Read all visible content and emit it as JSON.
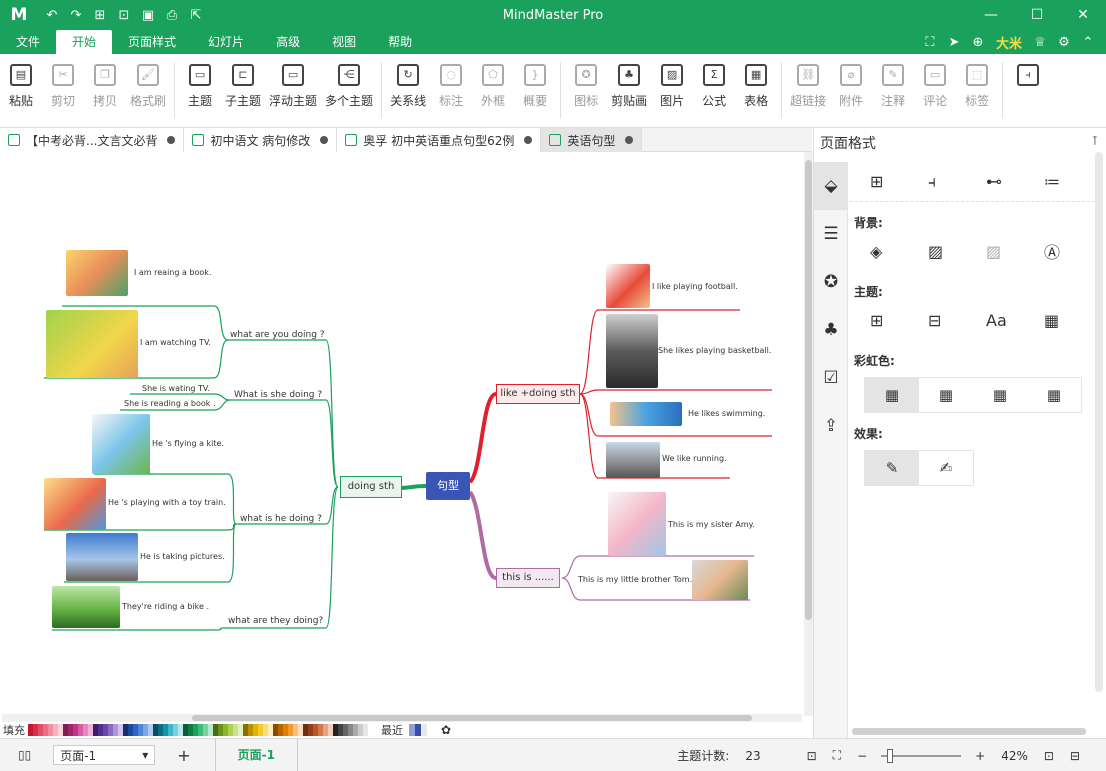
{
  "app": {
    "title": "MindMaster Pro",
    "logo": "M",
    "quick_access_icons": [
      "undo-icon",
      "redo-icon",
      "new-icon",
      "open-icon",
      "save-icon",
      "print-icon",
      "export-icon"
    ],
    "user": "大米"
  },
  "menu": {
    "items": [
      "文件",
      "开始",
      "页面样式",
      "幻灯片",
      "高级",
      "视图",
      "帮助"
    ],
    "active": "开始"
  },
  "ribbon": {
    "buttons": [
      {
        "label": "粘贴",
        "icon": "paste-icon",
        "glyph": "▤",
        "disabled": false
      },
      {
        "label": "剪切",
        "icon": "cut-icon",
        "glyph": "✂",
        "disabled": true
      },
      {
        "label": "拷贝",
        "icon": "copy-icon",
        "glyph": "❐",
        "disabled": true
      },
      {
        "label": "格式刷",
        "icon": "format-brush-icon",
        "glyph": "🖌",
        "disabled": true
      },
      {
        "label": "主题",
        "icon": "topic-icon",
        "glyph": "▭",
        "disabled": false
      },
      {
        "label": "子主题",
        "icon": "subtopic-icon",
        "glyph": "⊏",
        "disabled": false
      },
      {
        "label": "浮动主题",
        "icon": "floating-topic-icon",
        "glyph": "▭",
        "disabled": false
      },
      {
        "label": "多个主题",
        "icon": "multi-topic-icon",
        "glyph": "⋲",
        "disabled": false
      },
      {
        "label": "关系线",
        "icon": "relation-icon",
        "glyph": "↻",
        "disabled": false
      },
      {
        "label": "标注",
        "icon": "callout-icon",
        "glyph": "◌",
        "disabled": true
      },
      {
        "label": "外框",
        "icon": "boundary-icon",
        "glyph": "⬠",
        "disabled": true
      },
      {
        "label": "概要",
        "icon": "summary-icon",
        "glyph": "}",
        "disabled": true
      },
      {
        "label": "图标",
        "icon": "mark-icon",
        "glyph": "✪",
        "disabled": true
      },
      {
        "label": "剪贴画",
        "icon": "clipart-icon",
        "glyph": "♣",
        "disabled": false
      },
      {
        "label": "图片",
        "icon": "picture-icon",
        "glyph": "▨",
        "disabled": false
      },
      {
        "label": "公式",
        "icon": "formula-icon",
        "glyph": "Σ",
        "disabled": false
      },
      {
        "label": "表格",
        "icon": "table-icon",
        "glyph": "▦",
        "disabled": false
      },
      {
        "label": "超链接",
        "icon": "hyperlink-icon",
        "glyph": "⛓",
        "disabled": true
      },
      {
        "label": "附件",
        "icon": "attachment-icon",
        "glyph": "⌀",
        "disabled": true
      },
      {
        "label": "注释",
        "icon": "note-icon",
        "glyph": "✎",
        "disabled": true
      },
      {
        "label": "评论",
        "icon": "comment-icon",
        "glyph": "▭",
        "disabled": true
      },
      {
        "label": "标签",
        "icon": "tag-icon",
        "glyph": "⬚",
        "disabled": true
      }
    ]
  },
  "tabs": [
    {
      "label": "【中考必背...文言文必背",
      "active": false
    },
    {
      "label": "初中语文 病句修改",
      "active": false
    },
    {
      "label": "奥孚 初中英语重点句型62例",
      "active": false
    },
    {
      "label": "英语句型",
      "active": true
    }
  ],
  "mindmap": {
    "root": "句型",
    "left_main": "doing sth",
    "left_branches": [
      {
        "label": "what are you doing ?",
        "leaves": [
          "I am reaing a book.",
          "I am watching TV."
        ]
      },
      {
        "label": "What  is she doing ?",
        "leaves": [
          "She  is wating TV.",
          "She is reading a book ."
        ]
      },
      {
        "label": "what is he doing ?",
        "leaves": [
          "He 's flying a kite.",
          "He 's playing with a toy train.",
          "He is taking pictures."
        ]
      },
      {
        "label": "what are  they doing?",
        "leaves": [
          "They're riding a bike ."
        ]
      }
    ],
    "right_branches": [
      {
        "label": "like +doing sth",
        "leaves": [
          "I like playing football.",
          "She likes playing basketball.",
          "He likes swimming.",
          "We like running."
        ]
      },
      {
        "label": "this is ......",
        "leaves": [
          "This is my sister Amy.",
          "This is my little brother Tom."
        ]
      }
    ]
  },
  "panel": {
    "title": "页面格式",
    "sections": {
      "background": "背景:",
      "theme": "主题:",
      "rainbow": "彩虹色:",
      "effect": "效果:"
    }
  },
  "colorbar": {
    "fill_label": "填充",
    "recent_label": "最近",
    "swatches": [
      "#c4172c",
      "#d6314a",
      "#e04f68",
      "#ea6f86",
      "#f08fa1",
      "#f7b2bf",
      "#fbd3da",
      "#7f1d4d",
      "#a0266a",
      "#c13386",
      "#d75aa3",
      "#e685bf",
      "#f0b0d7",
      "#3b1c6d",
      "#51308e",
      "#6a48ab",
      "#8a6cc4",
      "#ad97da",
      "#d0c4ec",
      "#13306c",
      "#1c4b9e",
      "#2d66c4",
      "#4e86d8",
      "#7ca7e6",
      "#b0cbf2",
      "#064e5b",
      "#0a6f82",
      "#1493ab",
      "#40b4c9",
      "#7ad0df",
      "#b6e7ef",
      "#0b5b33",
      "#117a45",
      "#1aa15c",
      "#3dbb7a",
      "#78d3a2",
      "#b5ead0",
      "#4a6a0e",
      "#6b931a",
      "#8cb72a",
      "#abd154",
      "#c9e38d",
      "#e3f1c2",
      "#8a6d00",
      "#b89200",
      "#e0b500",
      "#f2cc2d",
      "#f8de76",
      "#fcefbc",
      "#8a4a00",
      "#b86500",
      "#e07f00",
      "#f29b2d",
      "#f8bd76",
      "#fcdcbc",
      "#6e2e12",
      "#94411b",
      "#ba5628",
      "#d17a50",
      "#e3a488",
      "#f2cdbd",
      "#222222",
      "#444444",
      "#666666",
      "#888888",
      "#aaaaaa",
      "#cccccc",
      "#e6e6e6",
      "#ffffff"
    ],
    "recent_swatches": [
      "#8da0d8",
      "#3a4fa3",
      "#e8e8e8"
    ]
  },
  "statusbar": {
    "page_select": "页面-1",
    "page_tab": "页面-1",
    "topic_count_label": "主题计数:",
    "topic_count": "23",
    "zoom": "42%"
  }
}
